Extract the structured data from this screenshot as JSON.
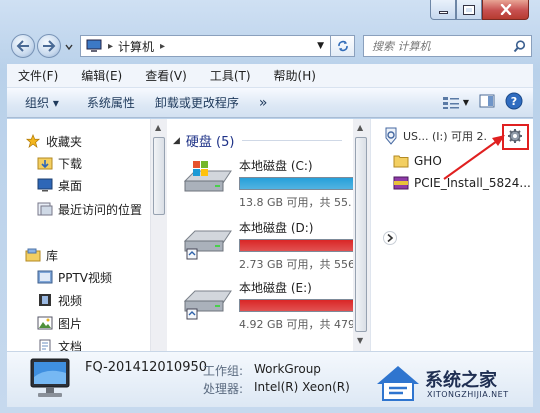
{
  "window": {
    "title": "计算机",
    "controls": {
      "minimize": "minimize-icon",
      "maximize": "maximize-icon",
      "close": "close-icon"
    }
  },
  "address_bar": {
    "path_root_icon": "computer-icon",
    "path": [
      "计算机"
    ],
    "refresh_icon": "refresh-icon",
    "search_placeholder": "搜索 计算机"
  },
  "menubar": {
    "items": [
      "文件(F)",
      "编辑(E)",
      "查看(V)",
      "工具(T)",
      "帮助(H)"
    ]
  },
  "toolbar": {
    "organize": "组织 ▾",
    "system_properties": "系统属性",
    "uninstall": "卸载或更改程序",
    "more": "»"
  },
  "nav": {
    "favorites": {
      "label": "收藏夹",
      "items": [
        "下载",
        "桌面",
        "最近访问的位置"
      ]
    },
    "libraries": {
      "label": "库",
      "items": [
        "PPTV视频",
        "视频",
        "图片",
        "文档"
      ]
    }
  },
  "content": {
    "group_title": "硬盘 (5)",
    "drives": [
      {
        "name": "本地磁盘 (C:)",
        "free": "13.8 GB 可用，共 55.",
        "used": 0.9,
        "color": "#26a0da"
      },
      {
        "name": "本地磁盘 (D:)",
        "free": "2.73 GB 可用，共 556",
        "used": 0.99,
        "color": "#da2626"
      },
      {
        "name": "本地磁盘 (E:)",
        "free": "4.92 GB 可用，共 479",
        "used": 0.99,
        "color": "#da2626"
      }
    ]
  },
  "preview": {
    "drive_label": "US... (I:)  可用 2.",
    "items": [
      "GHO",
      "PCIE_Install_5824..."
    ]
  },
  "details": {
    "computer_name": "FQ-201412010950",
    "workgroup_label": "工作组:",
    "workgroup_value": "WorkGroup",
    "processor_label": "处理器:",
    "processor_value": "Intel(R) Xeon(R)"
  },
  "watermark": {
    "brand": "系统之家",
    "url": "XITONGZHIJIA.NET"
  },
  "colors": {
    "highlight_box": "#e02020",
    "arrow": "#e02020"
  }
}
